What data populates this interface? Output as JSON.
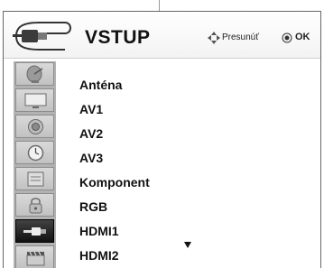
{
  "header": {
    "title": "VSTUP",
    "hint_move": "Presunúť",
    "hint_ok": "OK",
    "icon": "input-plug-icon"
  },
  "sidebar": {
    "items": [
      {
        "icon": "satellite-dish-icon",
        "selected": false
      },
      {
        "icon": "monitor-icon",
        "selected": false
      },
      {
        "icon": "speaker-icon",
        "selected": false
      },
      {
        "icon": "clock-icon",
        "selected": false
      },
      {
        "icon": "settings-box-icon",
        "selected": false
      },
      {
        "icon": "padlock-icon",
        "selected": false
      },
      {
        "icon": "input-plug-icon",
        "selected": true
      },
      {
        "icon": "film-clapper-icon",
        "selected": false
      }
    ]
  },
  "inputs": {
    "items": [
      {
        "label": "Anténa"
      },
      {
        "label": "AV1"
      },
      {
        "label": "AV2"
      },
      {
        "label": "AV3"
      },
      {
        "label": "Komponent"
      },
      {
        "label": "RGB"
      },
      {
        "label": "HDMI1"
      },
      {
        "label": "HDMI2"
      }
    ],
    "more_below": true
  },
  "colors": {
    "sidebar_bg": "#b2b2b2",
    "selected_tab": "#1a1a1a",
    "text": "#111111"
  }
}
